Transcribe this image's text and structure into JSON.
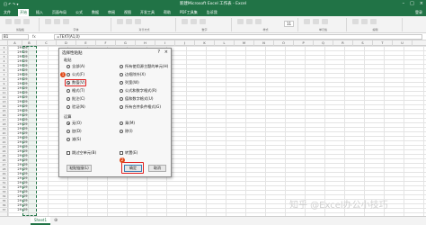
{
  "window": {
    "title": "新建Microsoft Excel 工作表 - Excel",
    "quick_access": "日 ↶ ↷ ▾",
    "signin": "登录"
  },
  "ribbon_tabs": [
    "文件",
    "开始",
    "插入",
    "页面布局",
    "公式",
    "数据",
    "审阅",
    "视图",
    "开发工具",
    "帮助",
    "PDF工具集",
    "告诉我"
  ],
  "ribbon_groups": [
    {
      "label": "剪贴板"
    },
    {
      "label": "字体"
    },
    {
      "label": "对齐方式"
    },
    {
      "label": "数字"
    },
    {
      "label": "样式"
    },
    {
      "label": "单元格"
    },
    {
      "label": "编辑"
    }
  ],
  "formula_bar": {
    "name_box": "B1",
    "fx": "fx",
    "formula": "=TEXT(A1,0)"
  },
  "font_box": "11",
  "columns": [
    "A",
    "B",
    "C",
    "D",
    "E",
    "F",
    "G",
    "H",
    "I",
    "J",
    "K",
    "L",
    "M",
    "N",
    "O",
    "P",
    "Q",
    "R",
    "S",
    "T",
    "U"
  ],
  "rows": [
    "1",
    "2",
    "3",
    "4",
    "5",
    "6",
    "7",
    "8",
    "9",
    "10",
    "11",
    "12",
    "13",
    "14",
    "15",
    "16",
    "17",
    "18",
    "19",
    "20",
    "21",
    "22",
    "23",
    "24",
    "25",
    "26",
    "27",
    "28",
    "29",
    "30",
    "31",
    "32",
    "33",
    "34",
    "35",
    "36",
    "37"
  ],
  "col_a": [
    "29",
    "29",
    "29",
    "29",
    "29",
    "29",
    "29",
    "29",
    "29",
    "29",
    "29",
    "29",
    "29",
    "29",
    "29",
    "29",
    "29",
    "29",
    "29",
    "29",
    "29",
    "29",
    "29",
    "29",
    "29",
    "29",
    "29",
    "29",
    "29",
    "29",
    "29",
    "29",
    "29",
    "29",
    "29",
    "29",
    "29"
  ],
  "col_b": [
    "29",
    "29",
    "29",
    "29",
    "29",
    "29",
    "29",
    "29",
    "29",
    "29",
    "29",
    "29",
    "29",
    "29",
    "29",
    "29",
    "29",
    "29",
    "29",
    "29",
    "29",
    "29",
    "29",
    "29",
    "29",
    "29",
    "29",
    "29",
    "29",
    "29",
    "29",
    "29",
    "29",
    "29",
    "29",
    "29",
    "29"
  ],
  "sheet": {
    "tab": "Sheet1",
    "add": "⊕"
  },
  "dialog": {
    "title": "选择性粘贴",
    "help": "?",
    "close": "×",
    "paste_section": "粘贴",
    "paste_left": [
      {
        "label": "全部(A)",
        "on": false
      },
      {
        "label": "公式(F)",
        "on": false
      },
      {
        "label": "数值(V)",
        "on": true
      },
      {
        "label": "格式(T)",
        "on": false
      },
      {
        "label": "批注(C)",
        "on": false
      },
      {
        "label": "验证(N)",
        "on": false
      }
    ],
    "paste_right": [
      {
        "label": "所有使用源主题的单元(H)",
        "on": false
      },
      {
        "label": "边框除外(X)",
        "on": false
      },
      {
        "label": "列宽(W)",
        "on": false
      },
      {
        "label": "公式和数字格式(R)",
        "on": false
      },
      {
        "label": "值和数字格式(U)",
        "on": false
      },
      {
        "label": "所有合并条件格式(G)",
        "on": false
      }
    ],
    "op_section": "运算",
    "op_left": [
      {
        "label": "无(O)",
        "on": true
      },
      {
        "label": "加(D)",
        "on": false
      },
      {
        "label": "减(S)",
        "on": false
      }
    ],
    "op_right": [
      {
        "label": "乘(M)",
        "on": false
      },
      {
        "label": "除(I)",
        "on": false
      }
    ],
    "skip_blanks": "跳过空单元(B)",
    "transpose": "转置(E)",
    "paste_link": "粘贴链接(L)",
    "ok": "确定",
    "cancel": "取消"
  },
  "badges": {
    "one": "1",
    "two": "2"
  },
  "watermark": "知乎 @Excel办公小技巧",
  "colors": {
    "excel_green": "#217346",
    "highlight_red": "#e02020",
    "badge": "#e04a1a"
  }
}
